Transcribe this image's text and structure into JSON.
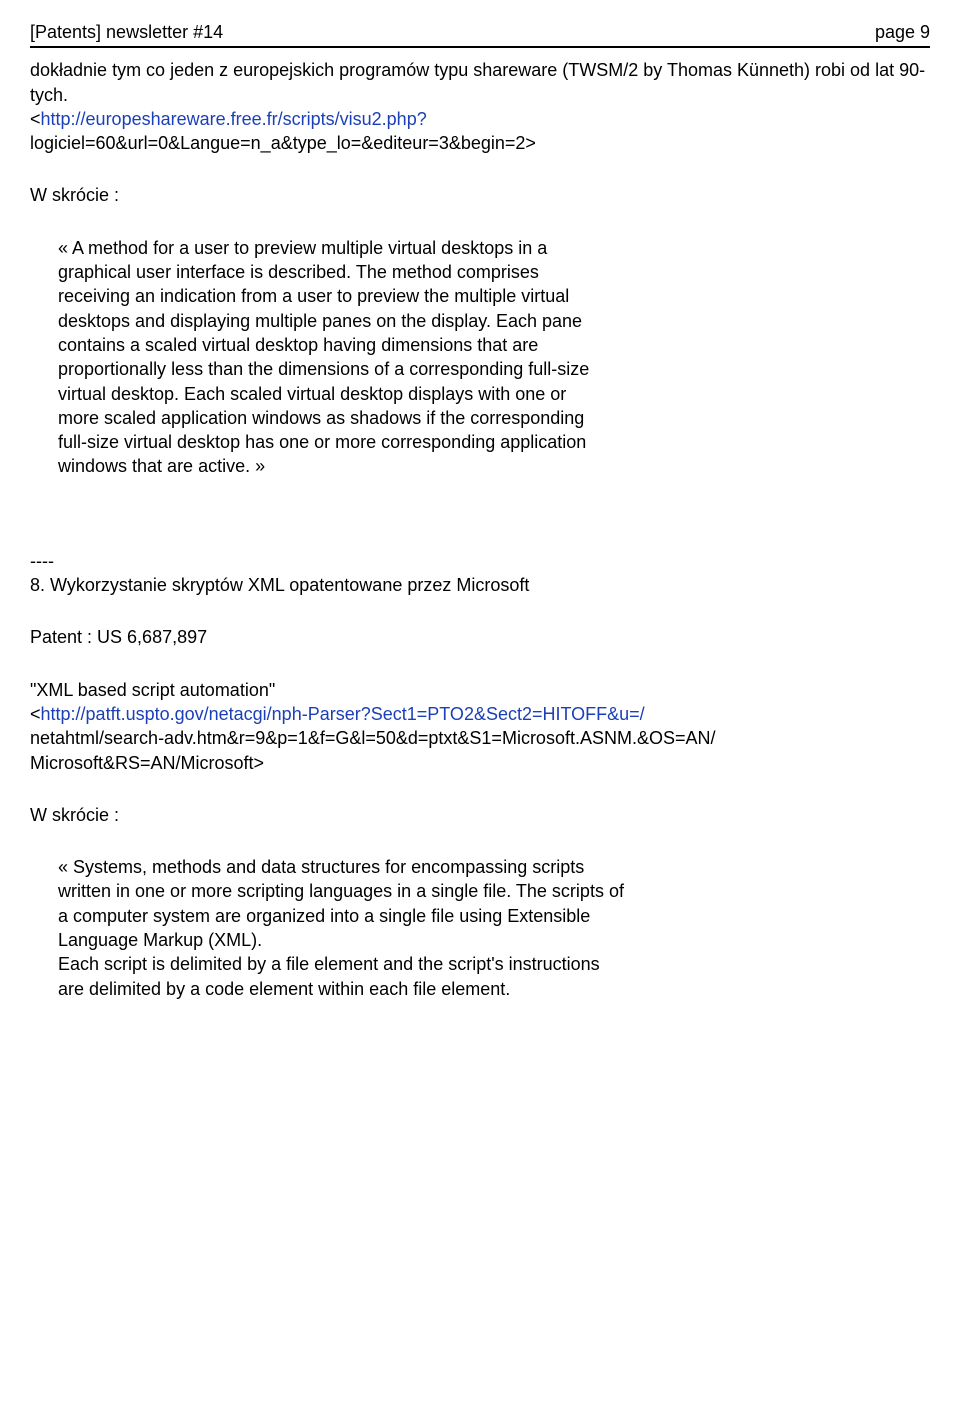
{
  "header": {
    "left": "[Patents] newsletter #14",
    "right": "page 9"
  },
  "intro": {
    "line1": "dokładnie tym co jeden z europejskich programów typu shareware (TWSM/2 by Thomas Künneth) robi od lat 90-tych.",
    "link_open": "<",
    "link_text": "http://europeshareware.free.fr/scripts/visu2.php?",
    "line2": "logiciel=60&url=0&Langue=n_a&type_lo=&editeur=3&begin=2>"
  },
  "summary_label": "W skrócie :",
  "quote1": "«  A method for a user to preview multiple virtual desktops in a graphical user interface is described. The method comprises receiving an indication  from a user to preview the multiple virtual desktops and displaying  multiple panes on the display. Each pane contains a scaled virtual desktop having dimensions that are proportionally less than the  dimensions of a corresponding full-size virtual desktop. Each scaled virtual desktop displays with one or more scaled application windows as  shadows if the corresponding full-size virtual desktop has one or more corresponding application windows that are active. »",
  "sep": "----",
  "section8_title": "8. Wykorzystanie skryptów XML opatentowane przez Microsoft",
  "patent_label": "Patent : US 6,687,897",
  "xml_title": "\"XML based script automation\"",
  "url2_open": "<",
  "url2_link": "http://patft.uspto.gov/netacgi/nph-Parser?Sect1=PTO2&Sect2=HITOFF&u=/",
  "url2_rest1": "netahtml/search-adv.htm&r=9&p=1&f=G&l=50&d=ptxt&S1=Microsoft.ASNM.&OS=AN/",
  "url2_rest2": "Microsoft&RS=AN/Microsoft>",
  "summary_label2": "W skrócie :",
  "quote2a": "« Systems, methods and data structures for encompassing scripts written in  one or more scripting languages in a single file. The scripts of a  computer system are organized into a single file using Extensible Language Markup (XML).",
  "quote2b": "Each script is delimited by a file element and the script's instructions are delimited by a code element within each file element."
}
